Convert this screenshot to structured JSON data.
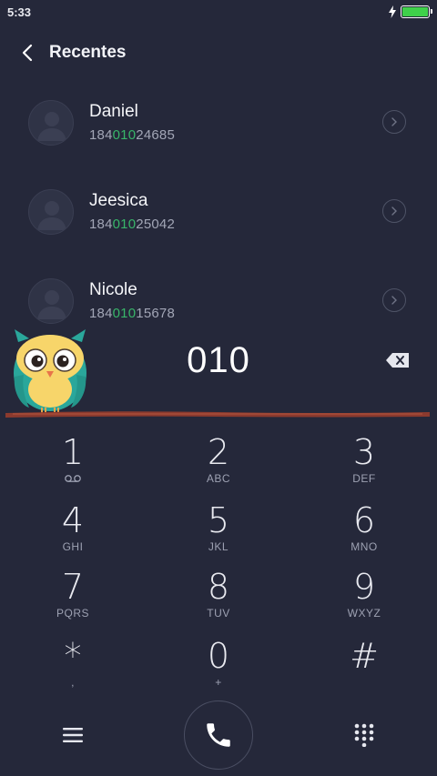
{
  "status_bar": {
    "time": "5:33"
  },
  "header": {
    "title": "Recentes"
  },
  "contacts": [
    {
      "name": "Daniel",
      "number_prefix": "184",
      "number_match": "010",
      "number_suffix": "24685"
    },
    {
      "name": "Jeesica",
      "number_prefix": "184",
      "number_match": "010",
      "number_suffix": "25042"
    },
    {
      "name": "Nicole",
      "number_prefix": "184",
      "number_match": "010",
      "number_suffix": "15678"
    }
  ],
  "dialer": {
    "typed_number": "010"
  },
  "keypad": [
    {
      "digit": "1",
      "letters": ""
    },
    {
      "digit": "2",
      "letters": "ABC"
    },
    {
      "digit": "3",
      "letters": "DEF"
    },
    {
      "digit": "4",
      "letters": "GHI"
    },
    {
      "digit": "5",
      "letters": "JKL"
    },
    {
      "digit": "6",
      "letters": "MNO"
    },
    {
      "digit": "7",
      "letters": "PQRS"
    },
    {
      "digit": "8",
      "letters": "TUV"
    },
    {
      "digit": "9",
      "letters": "WXYZ"
    },
    {
      "digit": "*",
      "letters": ","
    },
    {
      "digit": "0",
      "letters": "+"
    },
    {
      "digit": "#",
      "letters": ""
    }
  ],
  "colors": {
    "background": "#25283a",
    "match_highlight": "#38b569",
    "battery": "#3fd14a"
  },
  "icons": {
    "back": "chevron-left-icon",
    "contact_detail": "chevron-right-circle-icon",
    "backspace": "backspace-icon",
    "voicemail": "voicemail-icon",
    "menu": "hamburger-menu-icon",
    "call": "phone-icon",
    "dialpad": "dialpad-icon"
  }
}
